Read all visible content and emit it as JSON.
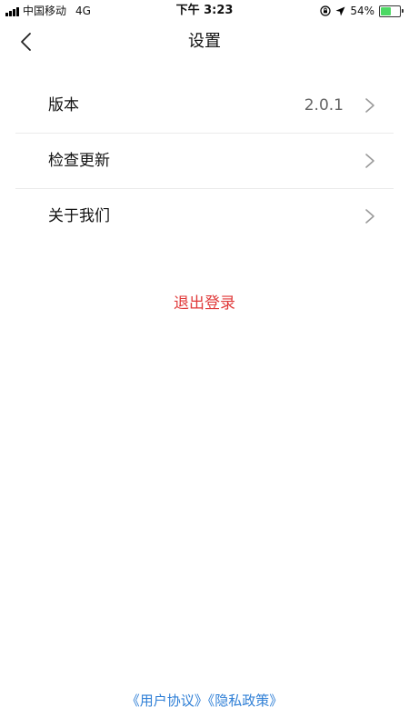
{
  "status_bar": {
    "carrier": "中国移动",
    "network": "4G",
    "time": "下午 3:23",
    "battery_percent": "54%",
    "battery_level": 0.54,
    "icons": [
      "signal-icon",
      "orientation-lock-icon",
      "location-icon",
      "battery-charging-icon"
    ]
  },
  "nav": {
    "title": "设置",
    "back_icon": "chevron-left-icon"
  },
  "settings": {
    "items": [
      {
        "label": "版本",
        "value": "2.0.1"
      },
      {
        "label": "检查更新",
        "value": ""
      },
      {
        "label": "关于我们",
        "value": ""
      }
    ]
  },
  "logout": {
    "label": "退出登录",
    "color": "#e03a3a"
  },
  "footer": {
    "user_agreement": "《用户协议》",
    "privacy_policy": "《隐私政策》",
    "link_color": "#2f7fd6"
  }
}
